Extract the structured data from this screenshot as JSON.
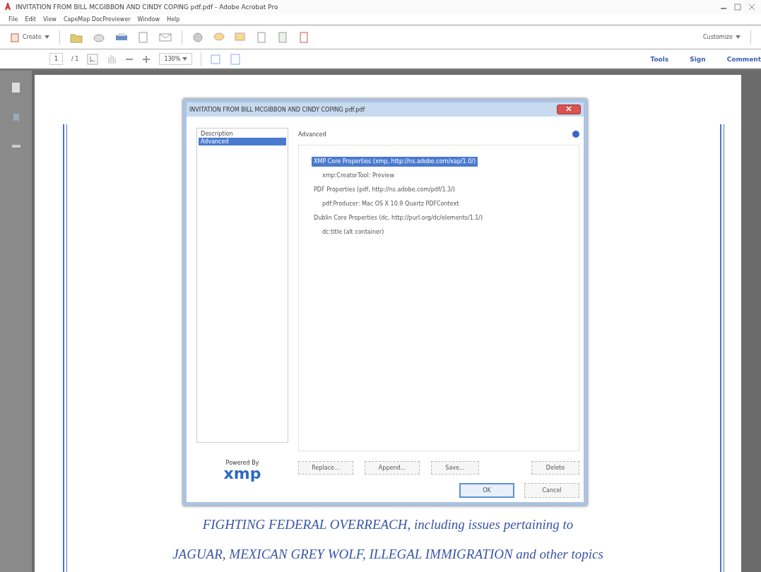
{
  "window": {
    "title": "INVITATION FROM BILL MCGIBBON AND CINDY COPING pdf.pdf - Adobe Acrobat Pro"
  },
  "menu": [
    "File",
    "Edit",
    "View",
    "CapeMap DocPreviewer",
    "Window",
    "Help"
  ],
  "toolbar": {
    "create": "Create",
    "customize": "Customize"
  },
  "nav": {
    "page": "1",
    "page_count": "/ 1",
    "zoom": "130%",
    "links": [
      "Tools",
      "Sign",
      "Comment"
    ]
  },
  "dialog": {
    "title": "INVITATION FROM BILL MCGIBBON AND CINDY COPING pdf.pdf",
    "categories": [
      {
        "label": "Description",
        "selected": false
      },
      {
        "label": "Advanced",
        "selected": true
      }
    ],
    "heading": "Advanced",
    "tree": [
      {
        "label": "XMP Core Properties (xmp, http://ns.adobe.com/xap/1.0/)",
        "selected": true,
        "children": [
          {
            "label": "xmp:CreatorTool: Preview",
            "selected": false
          }
        ]
      },
      {
        "label": "PDF Properties (pdf, http://ns.adobe.com/pdf/1.3/)",
        "selected": false,
        "children": [
          {
            "label": "pdf:Producer: Mac OS X 10.9 Quartz PDFContext",
            "selected": false
          }
        ]
      },
      {
        "label": "Dublin Core Properties (dc, http://purl.org/dc/elements/1.1/)",
        "selected": false,
        "children": [
          {
            "label": "dc:title (alt container)",
            "selected": false
          }
        ]
      }
    ],
    "logo": {
      "caption": "Powered By",
      "wordmark": "xmp"
    },
    "actions": [
      "Replace...",
      "Append...",
      "Save...",
      "Delete"
    ],
    "buttons": [
      {
        "label": "OK",
        "default": true
      },
      {
        "label": "Cancel",
        "default": false
      }
    ]
  },
  "document": {
    "lines": [
      "FIGHTING FEDERAL OVERREACH, *including issues pertaining to*",
      "JAGUAR, MEXICAN GREY WOLF, ILLEGAL IMMIGRATION *and other topics*"
    ]
  }
}
